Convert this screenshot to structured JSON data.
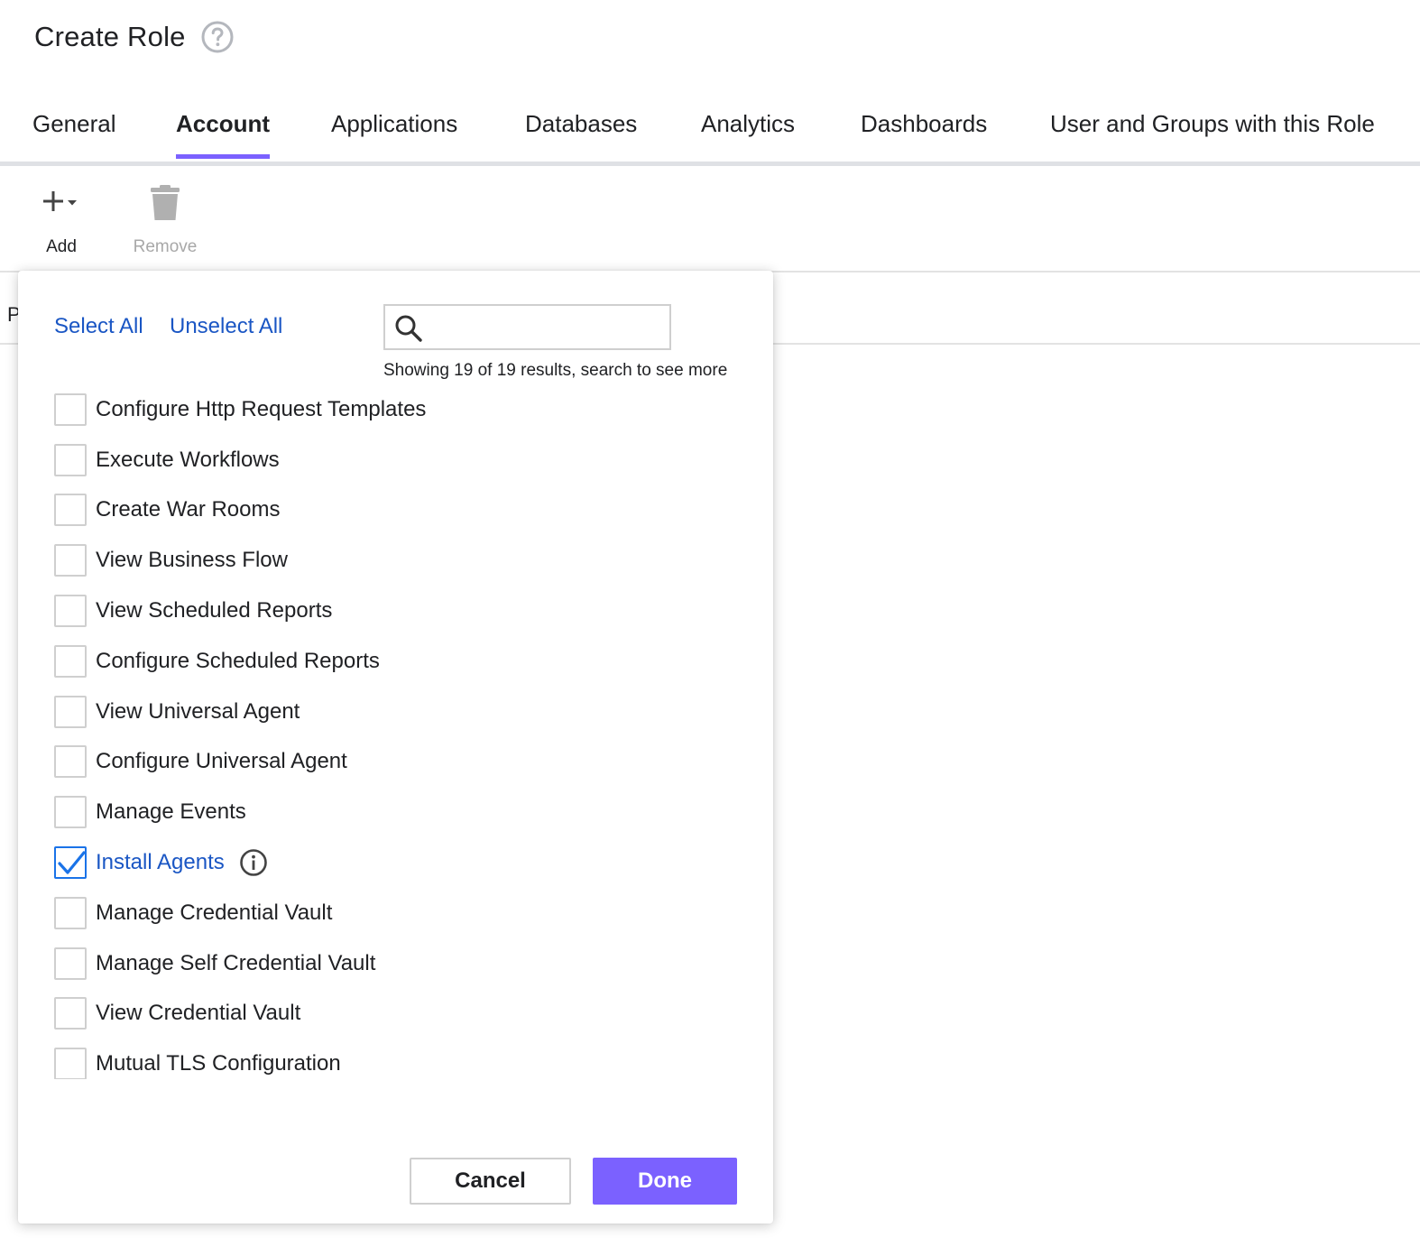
{
  "header": {
    "title": "Create Role",
    "help_icon": "help-circle-icon"
  },
  "tabs": [
    {
      "label": "General",
      "active": false
    },
    {
      "label": "Account",
      "active": true
    },
    {
      "label": "Applications",
      "active": false
    },
    {
      "label": "Databases",
      "active": false
    },
    {
      "label": "Analytics",
      "active": false
    },
    {
      "label": "Dashboards",
      "active": false
    },
    {
      "label": "User and Groups with this Role",
      "active": false
    }
  ],
  "toolbar": {
    "add_label": "Add",
    "remove_label": "Remove",
    "remove_disabled": true
  },
  "background": {
    "column_letter": "P"
  },
  "popup": {
    "select_all": "Select All",
    "unselect_all": "Unselect All",
    "search": {
      "value": "",
      "placeholder": ""
    },
    "results_note": "Showing 19 of 19 results, search to see more",
    "items": [
      {
        "label": "Configure Http Request Templates",
        "checked": false
      },
      {
        "label": "Execute Workflows",
        "checked": false
      },
      {
        "label": "Create War Rooms",
        "checked": false
      },
      {
        "label": "View Business Flow",
        "checked": false
      },
      {
        "label": "View Scheduled Reports",
        "checked": false
      },
      {
        "label": "Configure Scheduled Reports",
        "checked": false
      },
      {
        "label": "View Universal Agent",
        "checked": false
      },
      {
        "label": "Configure Universal Agent",
        "checked": false
      },
      {
        "label": "Manage Events",
        "checked": false
      },
      {
        "label": "Install Agents",
        "checked": true,
        "info": true
      },
      {
        "label": "Manage Credential Vault",
        "checked": false
      },
      {
        "label": "Manage Self Credential Vault",
        "checked": false
      },
      {
        "label": "View Credential Vault",
        "checked": false
      },
      {
        "label": "Mutual TLS Configuration",
        "checked": false
      }
    ],
    "cancel_label": "Cancel",
    "done_label": "Done"
  },
  "colors": {
    "accent": "#7b61ff",
    "link": "#1a56c4",
    "check": "#1a73e8"
  }
}
